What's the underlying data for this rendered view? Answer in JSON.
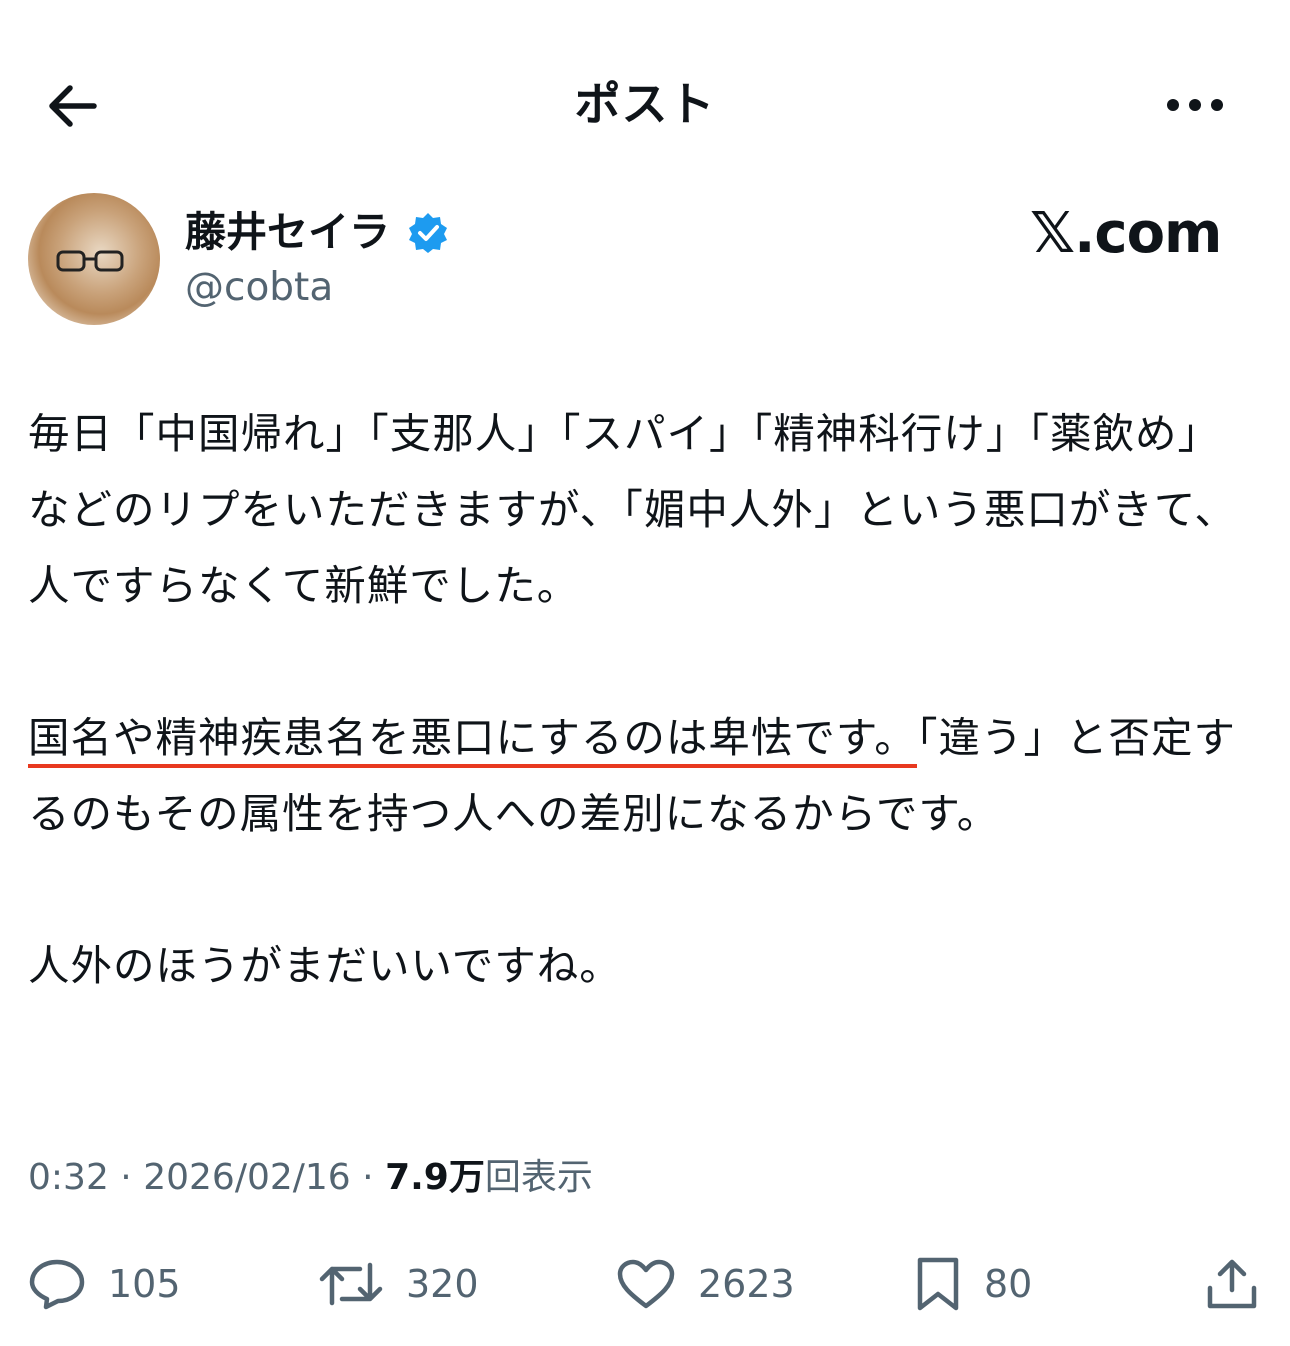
{
  "header": {
    "title": "ポスト",
    "back_icon": "arrow-left-icon",
    "more_icon": "more-horizontal-icon"
  },
  "author": {
    "display_name": "藤井セイラ",
    "handle": "@cobta",
    "verified_color": "#1d9bf0",
    "site_mark": "𝕏.com"
  },
  "post": {
    "paragraphs": [
      {
        "text": "毎日「中国帰れ」「支那人」「スパイ」「精神科行け」「薬飲め」などのリプをいただきますが、「媚中人外」という悪口がきて、人ですらなくて新鮮でした。"
      },
      {
        "underlined": "国名や精神疾患名を悪口にするのは卑怯です。",
        "rest": "「違う」と否定するのもその属性を持つ人への差別になるからです。"
      },
      {
        "text": "人外のほうがまだいいですね。"
      }
    ],
    "underline_color": "#e8391f"
  },
  "meta": {
    "time": "0:32",
    "separator": "·",
    "date": "2026/02/16",
    "views_number": "7.9万",
    "views_label": "回表示"
  },
  "actions": {
    "replies": "105",
    "reposts": "320",
    "likes": "2623",
    "bookmarks": "80"
  }
}
